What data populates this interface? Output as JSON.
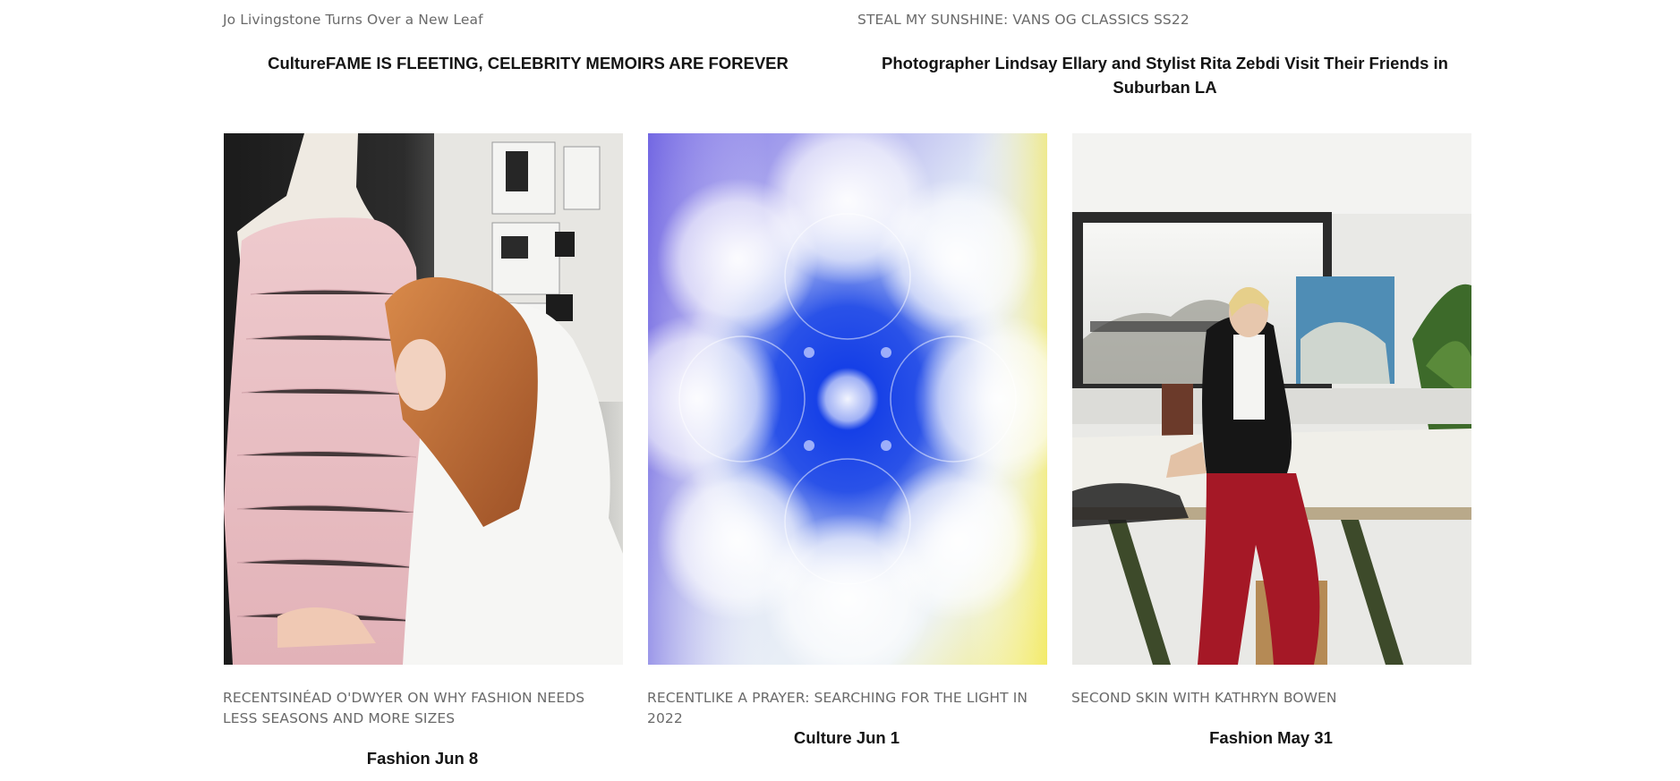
{
  "top_row": [
    {
      "kicker": "Jo Livingstone Turns Over a New Leaf",
      "headline": "CultureFAME IS FLEETING, CELEBRITY MEMOIRS ARE FOREVER"
    },
    {
      "kicker": "STEAL MY SUNSHINE: VANS OG CLASSICS SS22",
      "headline": "Photographer Lindsay Ellary and Stylist Rita Zebdi Visit Their Friends in Suburban LA"
    }
  ],
  "cards": [
    {
      "kicker": "RECENTSINÉAD O'DWYER ON WHY FASHION NEEDS LESS SEASONS AND MORE SIZES",
      "meta": "Fashion Jun 8",
      "image": "designer-fitting-dress-form-photo"
    },
    {
      "kicker": "RECENTLIKE A PRAYER: SEARCHING FOR THE LIGHT IN 2022",
      "meta": "Culture Jun 1",
      "image": "blue-aura-gradient-artwork"
    },
    {
      "kicker": "SECOND SKIN WITH KATHRYN BOWEN",
      "meta": "Fashion May 31",
      "image": "woman-seated-on-studio-table-photo"
    }
  ]
}
